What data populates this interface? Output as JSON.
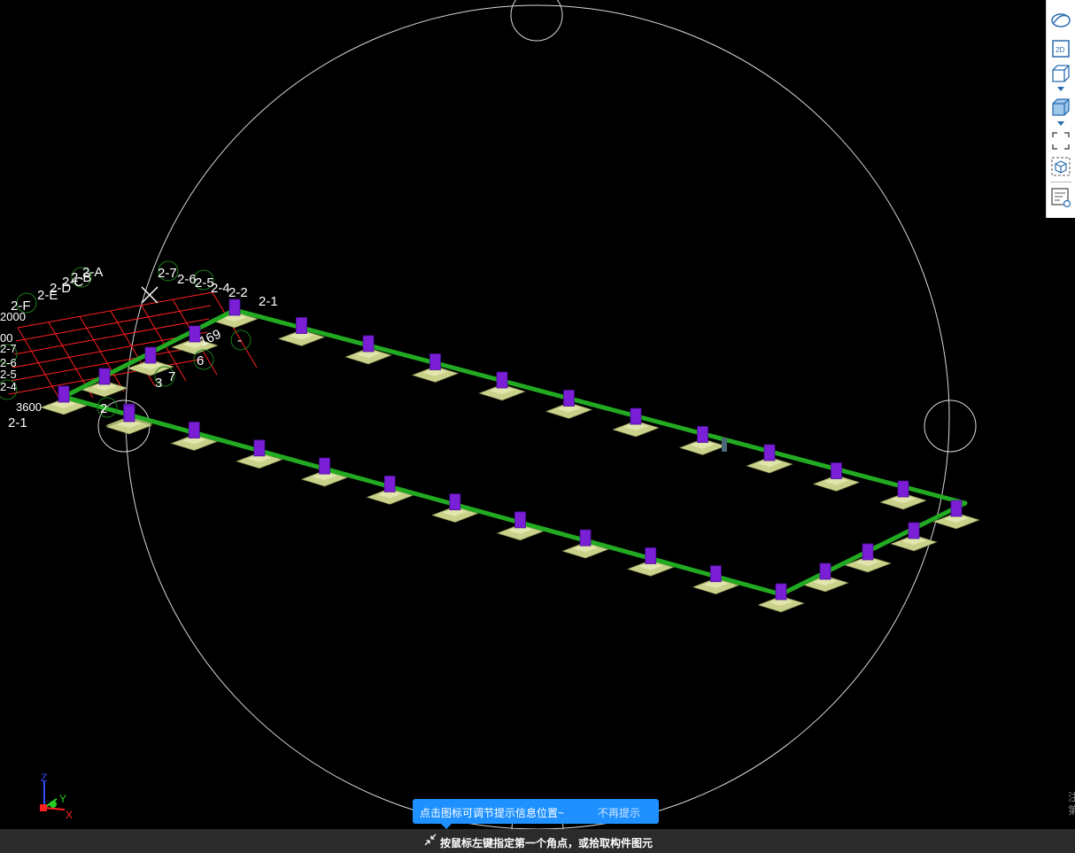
{
  "toolbar": {
    "items": [
      {
        "name": "orbit-view-icon"
      },
      {
        "name": "2d-view-icon",
        "label": "2D"
      },
      {
        "name": "wireframe-box-icon"
      },
      {
        "name": "shaded-box-icon"
      },
      {
        "name": "zoom-extents-icon"
      },
      {
        "name": "isolate-view-icon"
      },
      {
        "name": "properties-panel-icon"
      }
    ]
  },
  "axis_labels": {
    "top_right": "2-1",
    "bottom_left": "2-1",
    "left_cluster": [
      "2-F",
      "2-E",
      "2-D",
      "2-C",
      "2-B",
      "2-A"
    ],
    "top_cluster": [
      "2-7",
      "2-6",
      "2-5",
      "2-4",
      "2-2"
    ],
    "side_numbers": [
      "169",
      "6",
      "3",
      "7",
      "2",
      "-"
    ],
    "left_numbers": [
      "2000",
      "00",
      "2-7",
      "2-6",
      "2-5",
      "2-4",
      "3600"
    ]
  },
  "axis_triad": {
    "x": "X",
    "y": "Y",
    "z": "Z"
  },
  "tip": {
    "text": "点击图标可调节提示信息位置~",
    "dismiss": "不再提示"
  },
  "status": {
    "text": "按鼠标左键指定第一个角点，或拾取构件图元"
  },
  "edge_glyphs": "注\n第",
  "colors": {
    "background": "#000000",
    "beam": "#22aa22",
    "column": "#7a1fd6",
    "footing": "#c9d18a",
    "grid": "#ff2020",
    "tip": "#1e90ff"
  }
}
